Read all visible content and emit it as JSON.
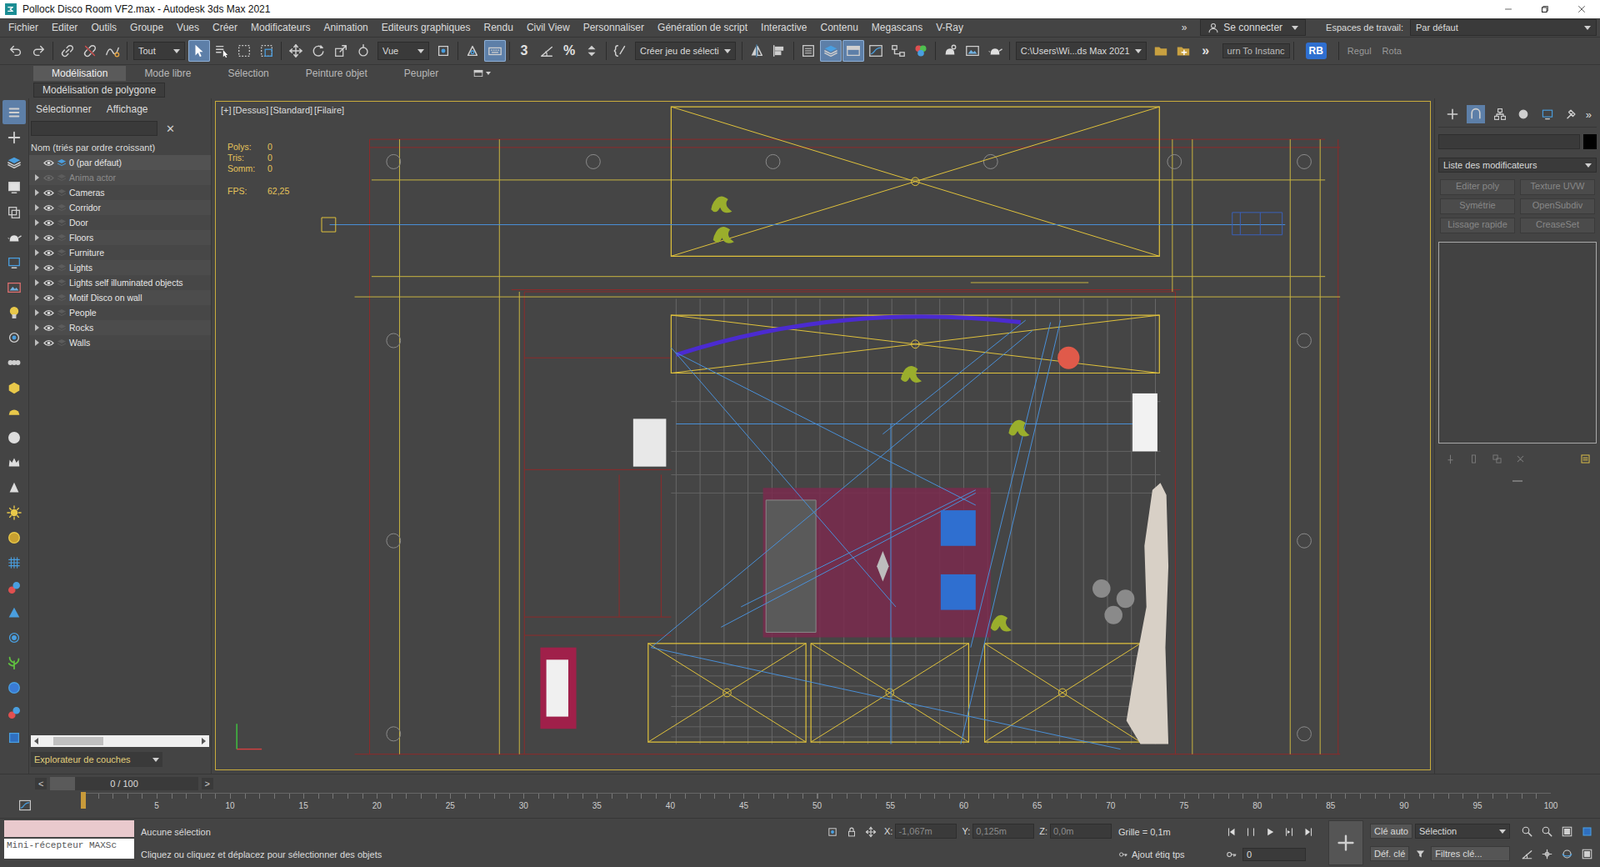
{
  "window": {
    "title": "Pollock Disco Room VF2.max - Autodesk 3ds Max 2021"
  },
  "menu": {
    "items": [
      "Fichier",
      "Editer",
      "Outils",
      "Groupe",
      "Vues",
      "Créer",
      "Modificateurs",
      "Animation",
      "Editeurs graphiques",
      "Rendu",
      "Civil View",
      "Personnaliser",
      "Génération de script",
      "Interactive",
      "Contenu",
      "Megascans",
      "V-Ray"
    ],
    "overflow": "»",
    "account": "Se connecter",
    "workspace_label": "Espaces de travail:",
    "workspace": "Par défaut"
  },
  "toolbar": {
    "items": [
      {
        "kind": "undo",
        "selected": false
      },
      {
        "kind": "redo",
        "selected": false
      },
      {
        "kind": "separator"
      },
      {
        "kind": "link",
        "selected": false
      },
      {
        "kind": "unlink",
        "selected": false
      },
      {
        "kind": "bind",
        "selected": false
      },
      {
        "kind": "separator"
      },
      {
        "kind": "dropdown",
        "label": "Tout"
      },
      {
        "kind": "select",
        "selected": true
      },
      {
        "kind": "selectname",
        "selected": false
      },
      {
        "kind": "region",
        "selected": false
      },
      {
        "kind": "crossing",
        "selected": false
      },
      {
        "kind": "separator"
      },
      {
        "kind": "move",
        "selected": false
      },
      {
        "kind": "rotate",
        "selected": false
      },
      {
        "kind": "scale",
        "selected": false
      },
      {
        "kind": "place",
        "selected": false
      },
      {
        "kind": "dropdown",
        "label": "Vue"
      },
      {
        "kind": "pivot",
        "selected": false
      },
      {
        "kind": "separator"
      },
      {
        "kind": "manip",
        "selected": false
      },
      {
        "kind": "keyboard",
        "selected": true
      },
      {
        "kind": "separator"
      },
      {
        "kind": "glyph",
        "label": "3",
        "selected": false
      },
      {
        "kind": "angle",
        "selected": false
      },
      {
        "kind": "glyph",
        "label": "%",
        "selected": false
      },
      {
        "kind": "spinner",
        "selected": false
      },
      {
        "kind": "separator"
      },
      {
        "kind": "named",
        "selected": false
      },
      {
        "kind": "dropdown",
        "label": "Créer jeu de sélecti"
      },
      {
        "kind": "separator"
      },
      {
        "kind": "mirror",
        "selected": false
      },
      {
        "kind": "align",
        "selected": false
      },
      {
        "kind": "separator"
      },
      {
        "kind": "explorer",
        "selected": false
      },
      {
        "kind": "layers",
        "selected": true
      },
      {
        "kind": "ribbon",
        "selected": true
      },
      {
        "kind": "curve",
        "selected": false
      },
      {
        "kind": "schematic",
        "selected": false
      },
      {
        "kind": "material",
        "selected": false
      },
      {
        "kind": "separator"
      },
      {
        "kind": "rendersetup",
        "selected": false
      },
      {
        "kind": "renderframe",
        "selected": false
      },
      {
        "kind": "render",
        "selected": false
      },
      {
        "kind": "separator"
      },
      {
        "kind": "dropdown",
        "label": "C:\\Users\\Wi...ds Max 2021"
      },
      {
        "kind": "project",
        "selected": false
      },
      {
        "kind": "project2",
        "selected": false
      },
      {
        "kind": "glyph",
        "label": "»",
        "selected": false
      },
      {
        "kind": "script",
        "label": "urn To Instanc"
      },
      {
        "kind": "separator"
      },
      {
        "kind": "badge",
        "label": "RB"
      },
      {
        "kind": "separator"
      },
      {
        "kind": "text",
        "label": "Regul"
      },
      {
        "kind": "text",
        "label": "Rota"
      }
    ]
  },
  "ribbon": {
    "tabs": [
      {
        "label": "Modélisation",
        "selected": true
      },
      {
        "label": "Mode libre",
        "selected": false
      },
      {
        "label": "Sélection",
        "selected": false
      },
      {
        "label": "Peinture objet",
        "selected": false
      },
      {
        "label": "Peupler",
        "selected": false
      }
    ],
    "panel": "Modélisation de polygone"
  },
  "side_tools": [
    {
      "kind": "list",
      "selected": true
    },
    {
      "kind": "plus",
      "selected": false
    },
    {
      "kind": "layers",
      "selected": false
    },
    {
      "kind": "display",
      "selected": false
    },
    {
      "kind": "stack",
      "selected": false
    },
    {
      "kind": "render",
      "selected": false
    },
    {
      "kind": "monitor",
      "selected": false
    },
    {
      "kind": "image",
      "selected": false
    },
    {
      "kind": "bulb",
      "selected": false
    },
    {
      "kind": "modifier",
      "selected": false
    },
    {
      "kind": "group",
      "selected": false
    },
    {
      "kind": "box",
      "selected": false
    },
    {
      "kind": "hemisphere",
      "selected": false
    },
    {
      "kind": "sphere",
      "selected": false
    },
    {
      "kind": "crown",
      "selected": false
    },
    {
      "kind": "cone",
      "selected": false
    },
    {
      "kind": "sun",
      "selected": false
    },
    {
      "kind": "ball",
      "selected": false
    },
    {
      "kind": "grid",
      "selected": false
    },
    {
      "kind": "tube",
      "selected": false
    },
    {
      "kind": "pyramid",
      "selected": false
    },
    {
      "kind": "gear",
      "selected": false
    },
    {
      "kind": "plant",
      "selected": false
    },
    {
      "kind": "globe",
      "selected": false
    },
    {
      "kind": "tube",
      "selected": false
    },
    {
      "kind": "cube",
      "selected": false
    }
  ],
  "explorer": {
    "tabs": [
      "Sélectionner",
      "Affichage"
    ],
    "search": "",
    "clear": "✕",
    "header": "Nom (triés par ordre croissant)",
    "rows": [
      {
        "name": "0 (par défaut)",
        "has_children": false,
        "expanded": false,
        "visible": true,
        "current": true
      },
      {
        "name": "Anima actor",
        "has_children": true,
        "expanded": false,
        "visible": false,
        "current": false
      },
      {
        "name": "Cameras",
        "has_children": true,
        "expanded": false,
        "visible": true,
        "current": false
      },
      {
        "name": "Corridor",
        "has_children": true,
        "expanded": false,
        "visible": true,
        "current": false
      },
      {
        "name": "Door",
        "has_children": true,
        "expanded": false,
        "visible": true,
        "current": false
      },
      {
        "name": "Floors",
        "has_children": true,
        "expanded": false,
        "visible": true,
        "current": false
      },
      {
        "name": "Furniture",
        "has_children": true,
        "expanded": false,
        "visible": true,
        "current": false
      },
      {
        "name": "Lights",
        "has_children": true,
        "expanded": false,
        "visible": true,
        "current": false
      },
      {
        "name": "Lights self illuminated objects",
        "has_children": true,
        "expanded": false,
        "visible": true,
        "current": false
      },
      {
        "name": "Motif Disco on wall",
        "has_children": true,
        "expanded": false,
        "visible": true,
        "current": false
      },
      {
        "name": "People",
        "has_children": true,
        "expanded": false,
        "visible": true,
        "current": false
      },
      {
        "name": "Rocks",
        "has_children": true,
        "expanded": false,
        "visible": true,
        "current": false
      },
      {
        "name": "Walls",
        "has_children": true,
        "expanded": false,
        "visible": true,
        "current": false
      }
    ],
    "footer": "Explorateur de couches"
  },
  "viewport": {
    "labels": [
      "[+]",
      "[Dessus]",
      "[Standard]",
      "[Filaire]"
    ],
    "stats": [
      {
        "label": "Polys:",
        "value": "0"
      },
      {
        "label": "Tris:",
        "value": "0"
      },
      {
        "label": "Somm:",
        "value": "0"
      }
    ],
    "fps": {
      "label": "FPS:",
      "value": "62,25"
    },
    "active": true
  },
  "command_panel": {
    "tabs": [
      {
        "kind": "plus",
        "selected": false
      },
      {
        "kind": "modify",
        "selected": true
      },
      {
        "kind": "hierarchy",
        "selected": false
      },
      {
        "kind": "motion",
        "selected": false
      },
      {
        "kind": "monitor",
        "selected": false
      },
      {
        "kind": "utilities",
        "selected": false
      }
    ],
    "overflow": "»",
    "name": "",
    "color": "#000000",
    "modifier_list": "Liste des modificateurs",
    "buttons": [
      {
        "label": "Editer poly",
        "disabled": true
      },
      {
        "label": "Texture UVW",
        "disabled": true
      },
      {
        "label": "Symétrie",
        "disabled": true
      },
      {
        "label": "OpenSubdiv",
        "disabled": true
      },
      {
        "label": "Lissage rapide",
        "disabled": true
      },
      {
        "label": "CreaseSet",
        "disabled": true
      }
    ],
    "stack_tools": [
      {
        "kind": "pin",
        "disabled": true
      },
      {
        "kind": "column",
        "disabled": true
      },
      {
        "kind": "unique",
        "disabled": true
      },
      {
        "kind": "remove",
        "disabled": true
      },
      {
        "kind": "configure",
        "disabled": false
      }
    ]
  },
  "time_slider": {
    "value": "0 / 100",
    "prev": "<",
    "next": ">",
    "level": 0
  },
  "track": {
    "ticks": [
      "5",
      "10",
      "15",
      "20",
      "25",
      "30",
      "35",
      "40",
      "45",
      "50",
      "55",
      "60",
      "65",
      "70",
      "75",
      "80",
      "85",
      "90",
      "95",
      "100"
    ]
  },
  "status": {
    "listener": "Mini-récepteur MAXSc",
    "selection": "Aucune sélection",
    "prompt": "Cliquez ou cliquez et déplacez pour sélectionner des objets",
    "coords": [
      {
        "axis": "X:",
        "value": "-1,067m",
        "disabled": true
      },
      {
        "axis": "Y:",
        "value": "0,125m",
        "disabled": true
      },
      {
        "axis": "Z:",
        "value": "0,0m",
        "disabled": true
      }
    ],
    "grid": "Grille = 0,1m",
    "time_tag": "Ajout étiq tps",
    "auto_key": "Clé auto",
    "key_mode": "Sélection",
    "set_key": "Déf. clé",
    "key_filters": "Filtres clé...",
    "frame": "0"
  }
}
